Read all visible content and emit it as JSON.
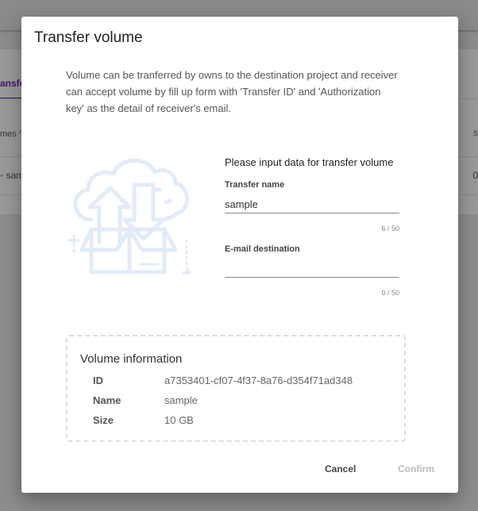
{
  "background": {
    "tab_label": "ansfe",
    "column_header": "mes ^",
    "column_header_right": "S",
    "row_cell": "sam",
    "row_cell_right": "0"
  },
  "dialog": {
    "title": "Transfer volume",
    "description": "Volume can be tranferred by owns to the destination project and receiver can accept volume by fill up form with 'Transfer ID' and 'Authorization key' as the detail of receiver's email.",
    "illustration_icon": "cloud-transfer-box-icon",
    "form": {
      "heading": "Please input data for transfer volume",
      "transfer_name": {
        "label": "Transfer name",
        "value": "sample",
        "counter": "6 / 50"
      },
      "email_destination": {
        "label": "E-mail destination",
        "value": "",
        "counter": "0 / 50"
      }
    },
    "volume_info": {
      "title": "Volume information",
      "rows": [
        {
          "key": "ID",
          "value": "a7353401-cf07-4f37-8a76-d354f71ad348"
        },
        {
          "key": "Name",
          "value": "sample"
        },
        {
          "key": "Size",
          "value": "10 GB"
        }
      ]
    },
    "buttons": {
      "cancel": "Cancel",
      "confirm": "Confirm"
    }
  },
  "colors": {
    "illustration": "#e3ebf9",
    "accent": "#3c1a66"
  }
}
